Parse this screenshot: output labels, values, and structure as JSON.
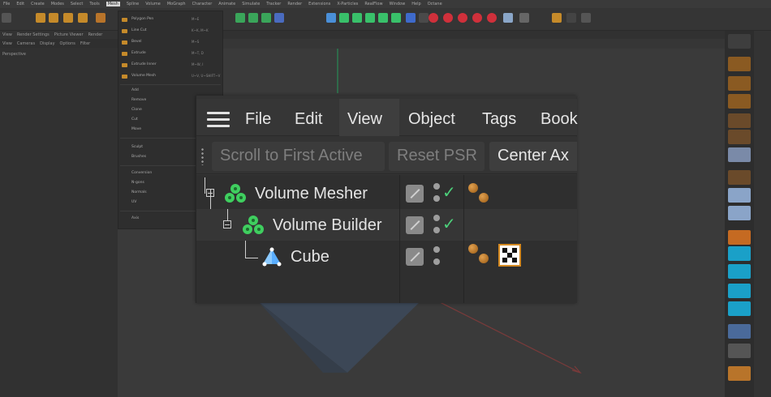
{
  "app_menu": [
    "File",
    "Edit",
    "Create",
    "Modes",
    "Select",
    "Tools",
    "Mesh",
    "Spline",
    "Volume",
    "MoGraph",
    "Character",
    "Animate",
    "Simulate",
    "Tracker",
    "Render",
    "Extensions",
    "X-Particles",
    "RealFlow",
    "Window",
    "Help",
    "Octane"
  ],
  "dropdown_items": [
    {
      "label": "Polygon Pen",
      "shortcut": "M~E"
    },
    {
      "label": "Line Cut",
      "shortcut": "K~K, M~K"
    },
    {
      "label": "Bevel",
      "shortcut": "M~S"
    },
    {
      "label": "Extrude",
      "shortcut": "M~T, D"
    },
    {
      "label": "Extrude Inner",
      "shortcut": "M~W, I"
    },
    {
      "label": "Volume Mesh",
      "shortcut": "U~V, U~SHIFT~V"
    },
    {
      "label": "Add",
      "shortcut": ""
    },
    {
      "label": "Remove",
      "shortcut": ""
    },
    {
      "label": "Clone",
      "shortcut": ""
    },
    {
      "label": "Cut",
      "shortcut": ""
    },
    {
      "label": "Move",
      "shortcut": ""
    },
    {
      "label": "Sculpt",
      "shortcut": ""
    },
    {
      "label": "Brushes",
      "shortcut": ""
    },
    {
      "label": "Conversion",
      "shortcut": ""
    },
    {
      "label": "N-gons",
      "shortcut": ""
    },
    {
      "label": "Normals",
      "shortcut": ""
    },
    {
      "label": "UV",
      "shortcut": ""
    },
    {
      "label": "Axis",
      "shortcut": ""
    }
  ],
  "sub_menu": [
    "View",
    "Render Settings",
    "Picture Viewer",
    "Render"
  ],
  "viewport_menu": [
    "View",
    "Cameras",
    "Display",
    "Options",
    "Filter"
  ],
  "viewport_label": "Perspective",
  "object_manager": {
    "menu": [
      "File",
      "Edit",
      "View",
      "Object",
      "Tags",
      "Book"
    ],
    "toolbar": [
      {
        "label": "Scroll to First Active",
        "active": false
      },
      {
        "label": "Reset PSR",
        "active": false
      },
      {
        "label": "Center Ax",
        "active": true
      }
    ],
    "objects": [
      {
        "name": "Volume Mesher",
        "enabled": true,
        "has_tag": true
      },
      {
        "name": "Volume Builder",
        "enabled": true,
        "has_tag": false
      },
      {
        "name": "Cube",
        "enabled": false,
        "has_tag": true,
        "has_material": true
      }
    ]
  },
  "colors": {
    "accent_orange": "#d58a22",
    "check_green": "#4cd07a",
    "generator_green": "#3fcf5f",
    "primitive_blue": "#5aaeff"
  }
}
